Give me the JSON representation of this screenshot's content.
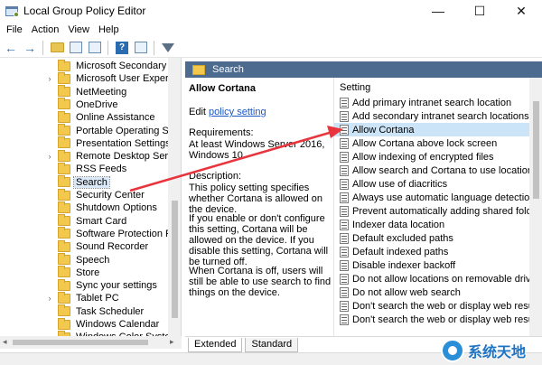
{
  "window": {
    "title": "Local Group Policy Editor",
    "controls": [
      "—",
      "☐",
      "✕"
    ]
  },
  "menu": [
    "File",
    "Action",
    "View",
    "Help"
  ],
  "tree": {
    "items": [
      {
        "label": "Microsoft Secondary Auth",
        "expandable": false
      },
      {
        "label": "Microsoft User Experience",
        "expandable": true
      },
      {
        "label": "NetMeeting",
        "expandable": false
      },
      {
        "label": "OneDrive",
        "expandable": false
      },
      {
        "label": "Online Assistance",
        "expandable": false
      },
      {
        "label": "Portable Operating Syster",
        "expandable": false
      },
      {
        "label": "Presentation Settings",
        "expandable": false
      },
      {
        "label": "Remote Desktop Services",
        "expandable": true
      },
      {
        "label": "RSS Feeds",
        "expandable": false
      },
      {
        "label": "Search",
        "expandable": false,
        "selected": true
      },
      {
        "label": "Security Center",
        "expandable": false
      },
      {
        "label": "Shutdown Options",
        "expandable": false
      },
      {
        "label": "Smart Card",
        "expandable": false
      },
      {
        "label": "Software Protection Platfo",
        "expandable": false
      },
      {
        "label": "Sound Recorder",
        "expandable": false
      },
      {
        "label": "Speech",
        "expandable": false
      },
      {
        "label": "Store",
        "expandable": false
      },
      {
        "label": "Sync your settings",
        "expandable": false
      },
      {
        "label": "Tablet PC",
        "expandable": true
      },
      {
        "label": "Task Scheduler",
        "expandable": false
      },
      {
        "label": "Windows Calendar",
        "expandable": false
      },
      {
        "label": "Windows Color System",
        "expandable": false
      }
    ]
  },
  "header": {
    "title": "Search"
  },
  "detail": {
    "title": "Allow Cortana",
    "edit_prefix": "Edit ",
    "edit_link": "policy setting",
    "requirements_label": "Requirements:",
    "requirements_text": "At least Windows Server 2016, Windows 10",
    "description_label": "Description:",
    "paragraphs": [
      "This policy setting specifies whether Cortana is allowed on the device.",
      "If you enable or don't configure this setting, Cortana will be allowed on the device. If you disable this setting, Cortana will be turned off.",
      "When Cortana is off, users will still be able to use search to find things on the device."
    ]
  },
  "list": {
    "column_header": "Setting",
    "items": [
      "Add primary intranet search location",
      "Add secondary intranet search locations",
      "Allow Cortana",
      "Allow Cortana above lock screen",
      "Allow indexing of encrypted files",
      "Allow search and Cortana to use location",
      "Allow use of diacritics",
      "Always use automatic language detection when",
      "Prevent automatically adding shared folders to",
      "Indexer data location",
      "Default excluded paths",
      "Default indexed paths",
      "Disable indexer backoff",
      "Do not allow locations on removable drives to b",
      "Do not allow web search",
      "Don't search the web or display web results in S",
      "Don't search the web or display web results in S"
    ],
    "selected_index": 2
  },
  "tabs": [
    "Extended",
    "Standard"
  ],
  "watermark": {
    "text": "系统天地"
  },
  "colors": {
    "header_bar": "#4d6a8f",
    "selection": "#cce4f7",
    "arrow": "#e8343c",
    "link": "#1a56c4"
  }
}
